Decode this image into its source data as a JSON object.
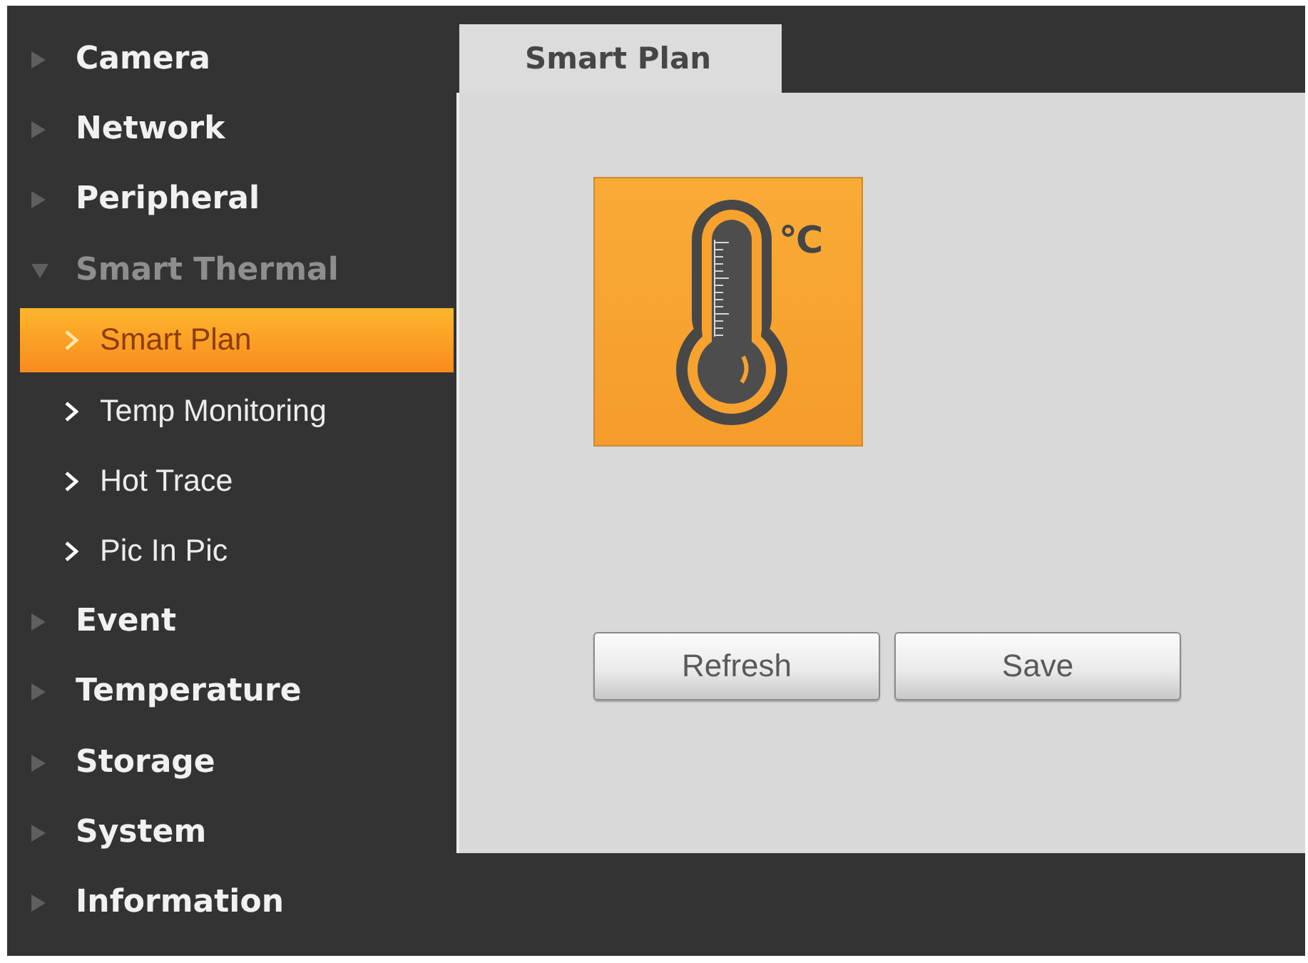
{
  "sidebar": {
    "items": [
      {
        "label": "Camera",
        "expanded": false
      },
      {
        "label": "Network",
        "expanded": false
      },
      {
        "label": "Peripheral",
        "expanded": false
      },
      {
        "label": "Smart Thermal",
        "expanded": true,
        "children": [
          {
            "label": "Smart Plan",
            "selected": true
          },
          {
            "label": "Temp Monitoring",
            "selected": false
          },
          {
            "label": "Hot Trace",
            "selected": false
          },
          {
            "label": "Pic In Pic",
            "selected": false
          }
        ]
      },
      {
        "label": "Event",
        "expanded": false
      },
      {
        "label": "Temperature",
        "expanded": false
      },
      {
        "label": "Storage",
        "expanded": false
      },
      {
        "label": "System",
        "expanded": false
      },
      {
        "label": "Information",
        "expanded": false
      }
    ]
  },
  "tabs": [
    {
      "label": "Smart Plan",
      "selected": true
    }
  ],
  "feature_tile": {
    "unit": "°C"
  },
  "buttons": [
    {
      "label": "Refresh"
    },
    {
      "label": "Save"
    }
  ]
}
